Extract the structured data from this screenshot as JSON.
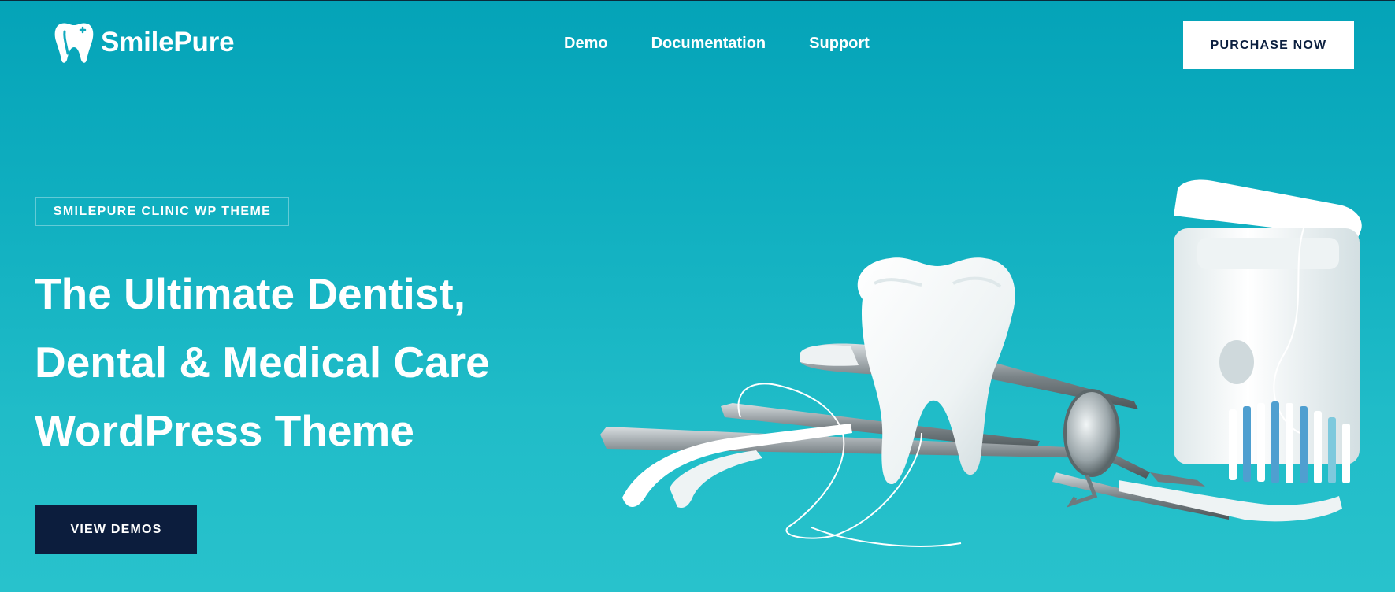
{
  "brand": {
    "name": "SmilePure",
    "icon": "tooth-icon"
  },
  "nav": {
    "items": [
      "Demo",
      "Documentation",
      "Support"
    ]
  },
  "header": {
    "cta_label": "PURCHASE NOW"
  },
  "hero": {
    "badge": "SMILEPURE CLINIC WP THEME",
    "headline_lines": [
      "The Ultimate Dentist,",
      "Dental & Medical Care",
      "WordPress Theme"
    ],
    "cta_label": "VIEW DEMOS",
    "image": "dental-tools-photo"
  },
  "colors": {
    "background": "#0fa9bd",
    "accent_dark": "#0c1d3d",
    "white": "#ffffff"
  }
}
